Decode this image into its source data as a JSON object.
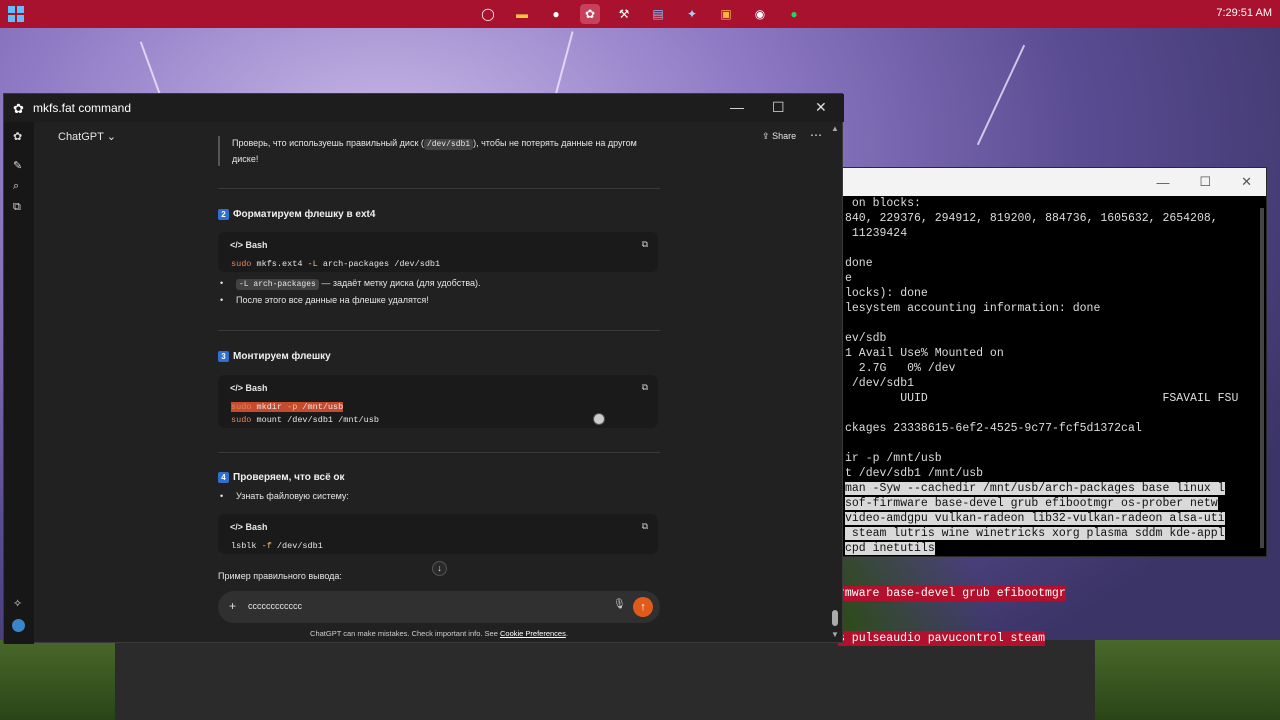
{
  "taskbar": {
    "clock": "7:29:51 AM",
    "icons": [
      "search-icon",
      "folder-icon",
      "record-icon",
      "chatgpt-icon",
      "tools-icon",
      "notes-icon",
      "settings-icon",
      "snip-icon",
      "github-icon",
      "spotify-icon"
    ]
  },
  "terminal": {
    "lines": [
      {
        "text": " on blocks:",
        "sel": false
      },
      {
        "text": "840, 229376, 294912, 819200, 884736, 1605632, 2654208,",
        "sel": false
      },
      {
        "text": " 11239424",
        "sel": false
      },
      {
        "text": "",
        "sel": false
      },
      {
        "text": "done",
        "sel": false
      },
      {
        "text": "e",
        "sel": false
      },
      {
        "text": "locks): done",
        "sel": false
      },
      {
        "text": "lesystem accounting information: done",
        "sel": false
      },
      {
        "text": "",
        "sel": false
      },
      {
        "text": "ev/sdb",
        "sel": false
      },
      {
        "text": "1 Avail Use% Mounted on",
        "sel": false
      },
      {
        "text": "  2.7G   0% /dev",
        "sel": false
      },
      {
        "text": " /dev/sdb1",
        "sel": false
      },
      {
        "text": "        UUID                                  FSAVAIL FSU",
        "sel": false
      },
      {
        "text": "",
        "sel": false
      },
      {
        "text": "ckages 23338615-6ef2-4525-9c77-fcf5d1372cal",
        "sel": false
      },
      {
        "text": "",
        "sel": false
      },
      {
        "text": "ir -p /mnt/usb",
        "sel": false
      },
      {
        "text": "t /dev/sdb1 /mnt/usb",
        "sel": false
      },
      {
        "text": "man -Syw --cachedir /mnt/usb/arch-packages base linux l",
        "sel": true
      },
      {
        "text": "sof-firmware base-devel grub efibootmgr os-prober netw",
        "sel": true
      },
      {
        "text": "video-amdgpu vulkan-radeon lib32-vulkan-radeon alsa-uti",
        "sel": true
      },
      {
        "text": " steam lutris wine winetricks xorg plasma sddm kde-appl",
        "sel": true
      },
      {
        "text": "cpd inetutils",
        "sel": true
      }
    ],
    "overflow_lines": [
      "rmware base-devel grub efibootmgr",
      "s pulseaudio pavucontrol steam"
    ]
  },
  "chat": {
    "window_title": "mkfs.fat command",
    "model_label": "ChatGPT",
    "share_label": "Share",
    "warning_text_pre": "Проверь, что используешь правильный диск (",
    "warning_code": "/dev/sdb1",
    "warning_text_post": "), чтобы не потерять данные на другом",
    "warning_text_line2": "диске!",
    "step2_num": "2",
    "step2_title": "Форматируем флешку в ext4",
    "code1_lang": "Bash",
    "code1": {
      "cmd": "sudo",
      "rest": " mkfs.ext4 ",
      "flag": "-L",
      "tail": " arch-packages /dev/sdb1"
    },
    "bullet1_code": "-L arch-packages",
    "bullet1_text": " — задаёт метку диска (для удобства).",
    "bullet2_text": "После этого все данные на флешке удалятся!",
    "step3_num": "3",
    "step3_title": "Монтируем флешку",
    "code2_lang": "Bash",
    "code2_line1": {
      "cmd": "sudo",
      "rest": " mkdir ",
      "flag": "-p",
      "tail": " /mnt/usb"
    },
    "code2_line2": {
      "cmd": "sudo",
      "rest": " mount /dev/sdb1 /mnt/usb"
    },
    "step4_num": "4",
    "step4_title": "Проверяем, что всё ок",
    "bullet3_text": "Узнать файловую систему:",
    "code3_lang": "Bash",
    "code3": {
      "cmd": "lsblk",
      "flag": " -f",
      "tail": " /dev/sdb1"
    },
    "example_label": "Пример правильного вывода:",
    "input_value": "cccccccccccc",
    "disclaimer_pre": "ChatGPT can make mistakes. Check important info. See ",
    "disclaimer_link": "Cookie Preferences",
    "disclaimer_post": "."
  }
}
